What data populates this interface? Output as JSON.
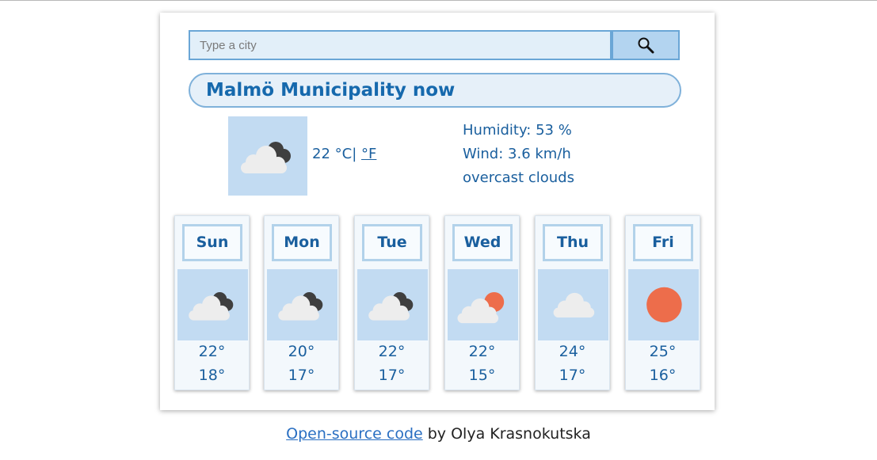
{
  "search": {
    "placeholder": "Type a city",
    "button_icon": "search-icon"
  },
  "current": {
    "heading": "Malmö Municipality now",
    "icon": "cloudy-icon",
    "temperature": "22",
    "unit_c": "°C|",
    "unit_f": "°F",
    "humidity": "Humidity: 53 %",
    "wind": "Wind: 3.6 km/h",
    "description": "overcast clouds"
  },
  "forecast": [
    {
      "day": "Sun",
      "icon": "cloudy-icon",
      "high": "22°",
      "low": "18°"
    },
    {
      "day": "Mon",
      "icon": "cloudy-icon",
      "high": "20°",
      "low": "17°"
    },
    {
      "day": "Tue",
      "icon": "cloudy-icon",
      "high": "22°",
      "low": "17°"
    },
    {
      "day": "Wed",
      "icon": "partly-sunny-icon",
      "high": "22°",
      "low": "15°"
    },
    {
      "day": "Thu",
      "icon": "cloud-icon",
      "high": "24°",
      "low": "17°"
    },
    {
      "day": "Fri",
      "icon": "sun-icon",
      "high": "25°",
      "low": "16°"
    }
  ],
  "footer": {
    "link_text": "Open-source code",
    "suffix": " by Olya Krasnokutska"
  },
  "colors": {
    "accent": "#1a5f9e",
    "sun": "#ed6d4b",
    "cloud_dark": "#3f3f3f",
    "cloud_light": "#ededed",
    "icon_bg": "#c2dbf2"
  }
}
